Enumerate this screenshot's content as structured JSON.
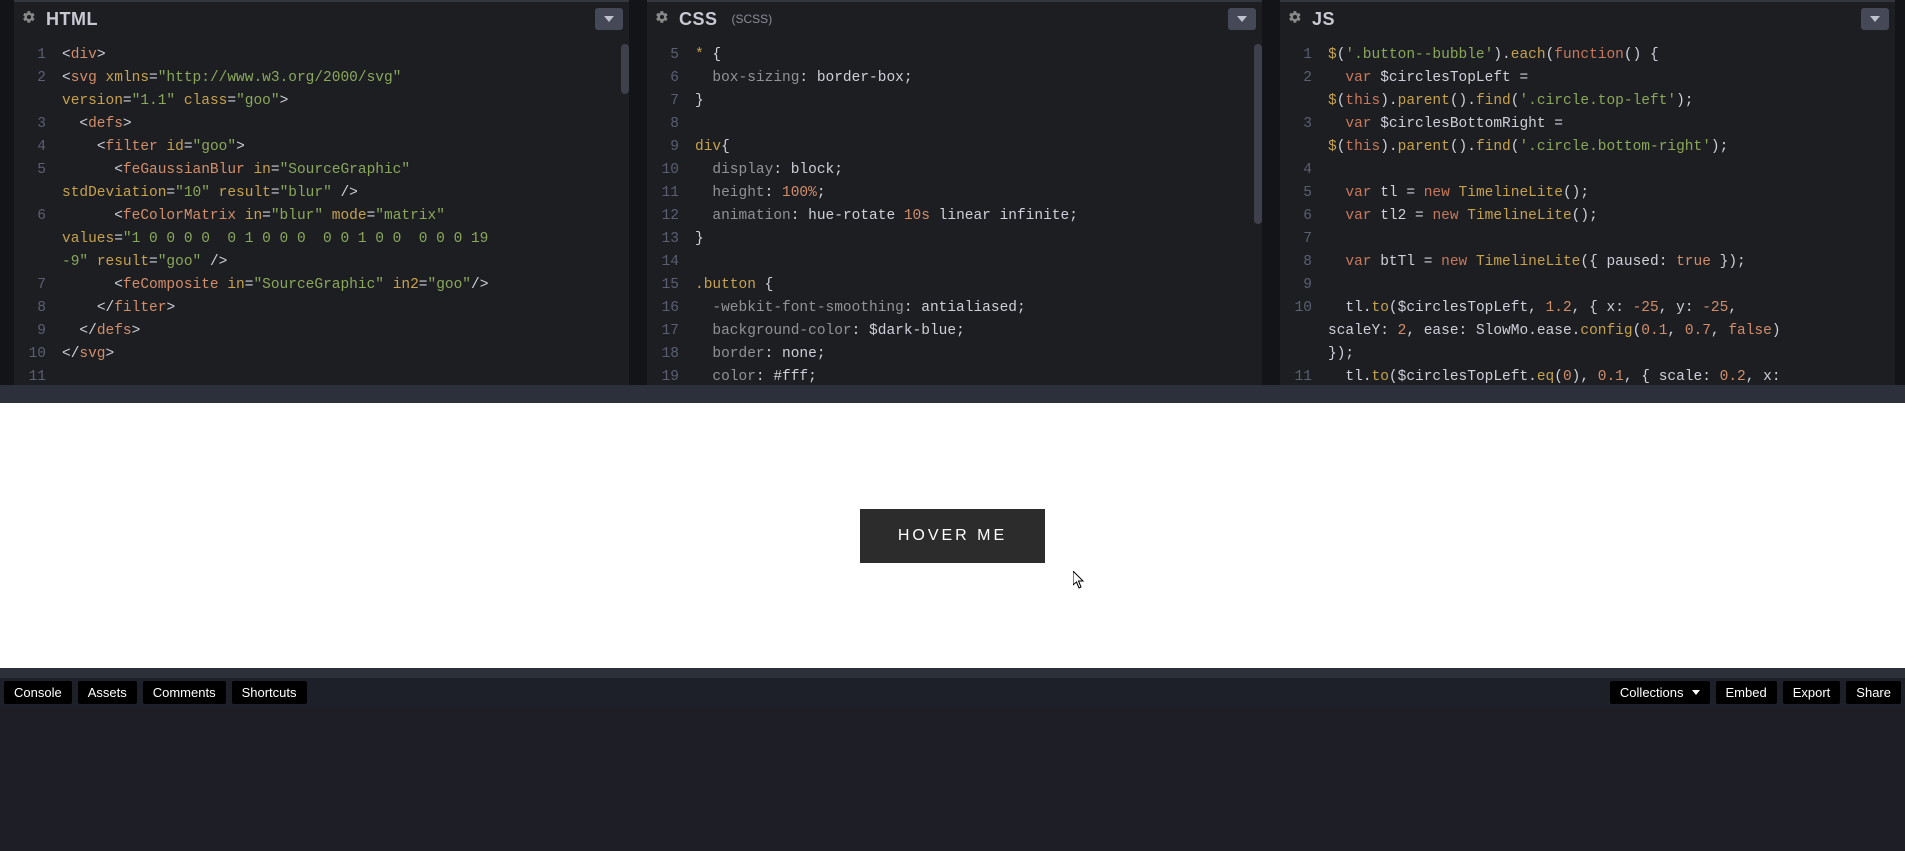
{
  "panels": {
    "html": {
      "title": "HTML",
      "sub": ""
    },
    "css": {
      "title": "CSS",
      "sub": "(SCSS)"
    },
    "js": {
      "title": "JS",
      "sub": ""
    }
  },
  "html_lines": [
    {
      "n": "1",
      "indent": 0,
      "segs": [
        [
          "t-punc",
          "<"
        ],
        [
          "t-tag",
          "div"
        ],
        [
          "t-punc",
          ">"
        ]
      ]
    },
    {
      "n": "2",
      "indent": 0,
      "segs": [
        [
          "t-punc",
          "<"
        ],
        [
          "t-tag",
          "svg"
        ],
        [
          "t-plain",
          " "
        ],
        [
          "t-attr",
          "xmlns"
        ],
        [
          "t-punc",
          "="
        ],
        [
          "t-str",
          "\"http://www.w3.org/2000/svg\""
        ]
      ]
    },
    {
      "n": "",
      "indent": 0,
      "segs": [
        [
          "t-attr",
          "version"
        ],
        [
          "t-punc",
          "="
        ],
        [
          "t-str",
          "\"1.1\""
        ],
        [
          "t-plain",
          " "
        ],
        [
          "t-attr",
          "class"
        ],
        [
          "t-punc",
          "="
        ],
        [
          "t-str",
          "\"goo\""
        ],
        [
          "t-punc",
          ">"
        ]
      ]
    },
    {
      "n": "3",
      "indent": 1,
      "segs": [
        [
          "t-punc",
          "<"
        ],
        [
          "t-tag",
          "defs"
        ],
        [
          "t-punc",
          ">"
        ]
      ]
    },
    {
      "n": "4",
      "indent": 2,
      "segs": [
        [
          "t-punc",
          "<"
        ],
        [
          "t-tag",
          "filter"
        ],
        [
          "t-plain",
          " "
        ],
        [
          "t-attr",
          "id"
        ],
        [
          "t-punc",
          "="
        ],
        [
          "t-str",
          "\"goo\""
        ],
        [
          "t-punc",
          ">"
        ]
      ]
    },
    {
      "n": "5",
      "indent": 3,
      "segs": [
        [
          "t-punc",
          "<"
        ],
        [
          "t-tag",
          "feGaussianBlur"
        ],
        [
          "t-plain",
          " "
        ],
        [
          "t-attr",
          "in"
        ],
        [
          "t-punc",
          "="
        ],
        [
          "t-str",
          "\"SourceGraphic\""
        ]
      ]
    },
    {
      "n": "",
      "indent": 0,
      "segs": [
        [
          "t-attr",
          "stdDeviation"
        ],
        [
          "t-punc",
          "="
        ],
        [
          "t-str",
          "\"10\""
        ],
        [
          "t-plain",
          " "
        ],
        [
          "t-attr",
          "result"
        ],
        [
          "t-punc",
          "="
        ],
        [
          "t-str",
          "\"blur\""
        ],
        [
          "t-plain",
          " "
        ],
        [
          "t-punc",
          "/>"
        ]
      ]
    },
    {
      "n": "6",
      "indent": 3,
      "segs": [
        [
          "t-punc",
          "<"
        ],
        [
          "t-tag",
          "feColorMatrix"
        ],
        [
          "t-plain",
          " "
        ],
        [
          "t-attr",
          "in"
        ],
        [
          "t-punc",
          "="
        ],
        [
          "t-str",
          "\"blur\""
        ],
        [
          "t-plain",
          " "
        ],
        [
          "t-attr",
          "mode"
        ],
        [
          "t-punc",
          "="
        ],
        [
          "t-str",
          "\"matrix\""
        ]
      ]
    },
    {
      "n": "",
      "indent": 0,
      "segs": [
        [
          "t-attr",
          "values"
        ],
        [
          "t-punc",
          "="
        ],
        [
          "t-str",
          "\"1 0 0 0 0  0 1 0 0 0  0 0 1 0 0  0 0 0 19"
        ]
      ]
    },
    {
      "n": "",
      "indent": 0,
      "segs": [
        [
          "t-str",
          "-9\""
        ],
        [
          "t-plain",
          " "
        ],
        [
          "t-attr",
          "result"
        ],
        [
          "t-punc",
          "="
        ],
        [
          "t-str",
          "\"goo\""
        ],
        [
          "t-plain",
          " "
        ],
        [
          "t-punc",
          "/>"
        ]
      ]
    },
    {
      "n": "7",
      "indent": 3,
      "segs": [
        [
          "t-punc",
          "<"
        ],
        [
          "t-tag",
          "feComposite"
        ],
        [
          "t-plain",
          " "
        ],
        [
          "t-attr",
          "in"
        ],
        [
          "t-punc",
          "="
        ],
        [
          "t-str",
          "\"SourceGraphic\""
        ],
        [
          "t-plain",
          " "
        ],
        [
          "t-attr",
          "in2"
        ],
        [
          "t-punc",
          "="
        ],
        [
          "t-str",
          "\"goo\""
        ],
        [
          "t-punc",
          "/>"
        ]
      ]
    },
    {
      "n": "8",
      "indent": 2,
      "segs": [
        [
          "t-punc",
          "</"
        ],
        [
          "t-tag",
          "filter"
        ],
        [
          "t-punc",
          ">"
        ]
      ]
    },
    {
      "n": "9",
      "indent": 1,
      "segs": [
        [
          "t-punc",
          "</"
        ],
        [
          "t-tag",
          "defs"
        ],
        [
          "t-punc",
          ">"
        ]
      ]
    },
    {
      "n": "10",
      "indent": 0,
      "segs": [
        [
          "t-punc",
          "</"
        ],
        [
          "t-tag",
          "svg"
        ],
        [
          "t-punc",
          ">"
        ]
      ]
    },
    {
      "n": "11",
      "indent": 0,
      "segs": []
    }
  ],
  "css_lines": [
    {
      "n": "5",
      "indent": 0,
      "segs": [
        [
          "t-sel",
          "*"
        ],
        [
          "t-plain",
          " "
        ],
        [
          "t-punc",
          "{"
        ]
      ]
    },
    {
      "n": "6",
      "indent": 1,
      "segs": [
        [
          "t-prop",
          "box-sizing"
        ],
        [
          "t-punc",
          ": "
        ],
        [
          "t-val",
          "border-box"
        ],
        [
          "t-punc",
          ";"
        ]
      ]
    },
    {
      "n": "7",
      "indent": 0,
      "segs": [
        [
          "t-punc",
          "}"
        ]
      ]
    },
    {
      "n": "8",
      "indent": 0,
      "segs": []
    },
    {
      "n": "9",
      "indent": 0,
      "segs": [
        [
          "t-sel",
          "div"
        ],
        [
          "t-punc",
          "{"
        ]
      ]
    },
    {
      "n": "10",
      "indent": 1,
      "segs": [
        [
          "t-prop",
          "display"
        ],
        [
          "t-punc",
          ": "
        ],
        [
          "t-val",
          "block"
        ],
        [
          "t-punc",
          ";"
        ]
      ]
    },
    {
      "n": "11",
      "indent": 1,
      "segs": [
        [
          "t-prop",
          "height"
        ],
        [
          "t-punc",
          ": "
        ],
        [
          "t-num",
          "100%"
        ],
        [
          "t-punc",
          ";"
        ]
      ]
    },
    {
      "n": "12",
      "indent": 1,
      "segs": [
        [
          "t-prop",
          "animation"
        ],
        [
          "t-punc",
          ": "
        ],
        [
          "t-val",
          "hue-rotate "
        ],
        [
          "t-num",
          "10s"
        ],
        [
          "t-val",
          " linear infinite"
        ],
        [
          "t-punc",
          ";"
        ]
      ]
    },
    {
      "n": "13",
      "indent": 0,
      "segs": [
        [
          "t-punc",
          "}"
        ]
      ]
    },
    {
      "n": "14",
      "indent": 0,
      "segs": []
    },
    {
      "n": "15",
      "indent": 0,
      "segs": [
        [
          "t-sel",
          ".button"
        ],
        [
          "t-plain",
          " "
        ],
        [
          "t-punc",
          "{"
        ]
      ]
    },
    {
      "n": "16",
      "indent": 1,
      "segs": [
        [
          "t-prop",
          "-webkit-font-smoothing"
        ],
        [
          "t-punc",
          ": "
        ],
        [
          "t-val",
          "antialiased"
        ],
        [
          "t-punc",
          ";"
        ]
      ]
    },
    {
      "n": "17",
      "indent": 1,
      "segs": [
        [
          "t-prop",
          "background-color"
        ],
        [
          "t-punc",
          ": "
        ],
        [
          "t-val",
          "$dark-blue"
        ],
        [
          "t-punc",
          ";"
        ]
      ]
    },
    {
      "n": "18",
      "indent": 1,
      "segs": [
        [
          "t-prop",
          "border"
        ],
        [
          "t-punc",
          ": "
        ],
        [
          "t-val",
          "none"
        ],
        [
          "t-punc",
          ";"
        ]
      ]
    },
    {
      "n": "19",
      "indent": 1,
      "segs": [
        [
          "t-prop",
          "color"
        ],
        [
          "t-punc",
          ": "
        ],
        [
          "t-val",
          "#fff"
        ],
        [
          "t-punc",
          ";"
        ]
      ]
    }
  ],
  "js_lines": [
    {
      "n": "1",
      "indent": 0,
      "segs": [
        [
          "t-fn",
          "$"
        ],
        [
          "t-punc",
          "("
        ],
        [
          "t-str",
          "'.button--bubble'"
        ],
        [
          "t-punc",
          ")."
        ],
        [
          "t-fn",
          "each"
        ],
        [
          "t-punc",
          "("
        ],
        [
          "t-kw",
          "function"
        ],
        [
          "t-punc",
          "() {"
        ]
      ]
    },
    {
      "n": "2",
      "indent": 1,
      "segs": [
        [
          "t-kw",
          "var"
        ],
        [
          "t-plain",
          " "
        ],
        [
          "t-var",
          "$circlesTopLeft"
        ],
        [
          "t-plain",
          " "
        ],
        [
          "t-punc",
          "="
        ],
        [
          "t-plain",
          " "
        ]
      ]
    },
    {
      "n": "",
      "indent": 0,
      "segs": [
        [
          "t-fn",
          "$"
        ],
        [
          "t-punc",
          "("
        ],
        [
          "t-kw",
          "this"
        ],
        [
          "t-punc",
          ")."
        ],
        [
          "t-fn",
          "parent"
        ],
        [
          "t-punc",
          "()."
        ],
        [
          "t-fn",
          "find"
        ],
        [
          "t-punc",
          "("
        ],
        [
          "t-str",
          "'.circle.top-left'"
        ],
        [
          "t-punc",
          ");"
        ]
      ]
    },
    {
      "n": "3",
      "indent": 1,
      "segs": [
        [
          "t-kw",
          "var"
        ],
        [
          "t-plain",
          " "
        ],
        [
          "t-var",
          "$circlesBottomRight"
        ],
        [
          "t-plain",
          " "
        ],
        [
          "t-punc",
          "="
        ],
        [
          "t-plain",
          " "
        ]
      ]
    },
    {
      "n": "",
      "indent": 0,
      "segs": [
        [
          "t-fn",
          "$"
        ],
        [
          "t-punc",
          "("
        ],
        [
          "t-kw",
          "this"
        ],
        [
          "t-punc",
          ")."
        ],
        [
          "t-fn",
          "parent"
        ],
        [
          "t-punc",
          "()."
        ],
        [
          "t-fn",
          "find"
        ],
        [
          "t-punc",
          "("
        ],
        [
          "t-str",
          "'.circle.bottom-right'"
        ],
        [
          "t-punc",
          ");"
        ]
      ]
    },
    {
      "n": "4",
      "indent": 0,
      "segs": []
    },
    {
      "n": "5",
      "indent": 1,
      "segs": [
        [
          "t-kw",
          "var"
        ],
        [
          "t-plain",
          " "
        ],
        [
          "t-var",
          "tl"
        ],
        [
          "t-plain",
          " "
        ],
        [
          "t-punc",
          "="
        ],
        [
          "t-plain",
          " "
        ],
        [
          "t-kw",
          "new"
        ],
        [
          "t-plain",
          " "
        ],
        [
          "t-fn",
          "TimelineLite"
        ],
        [
          "t-punc",
          "();"
        ]
      ]
    },
    {
      "n": "6",
      "indent": 1,
      "segs": [
        [
          "t-kw",
          "var"
        ],
        [
          "t-plain",
          " "
        ],
        [
          "t-var",
          "tl2"
        ],
        [
          "t-plain",
          " "
        ],
        [
          "t-punc",
          "="
        ],
        [
          "t-plain",
          " "
        ],
        [
          "t-kw",
          "new"
        ],
        [
          "t-plain",
          " "
        ],
        [
          "t-fn",
          "TimelineLite"
        ],
        [
          "t-punc",
          "();"
        ]
      ]
    },
    {
      "n": "7",
      "indent": 0,
      "segs": []
    },
    {
      "n": "8",
      "indent": 1,
      "segs": [
        [
          "t-kw",
          "var"
        ],
        [
          "t-plain",
          " "
        ],
        [
          "t-var",
          "btTl"
        ],
        [
          "t-plain",
          " "
        ],
        [
          "t-punc",
          "="
        ],
        [
          "t-plain",
          " "
        ],
        [
          "t-kw",
          "new"
        ],
        [
          "t-plain",
          " "
        ],
        [
          "t-fn",
          "TimelineLite"
        ],
        [
          "t-punc",
          "({ "
        ],
        [
          "t-var",
          "paused"
        ],
        [
          "t-punc",
          ": "
        ],
        [
          "t-bool",
          "true"
        ],
        [
          "t-punc",
          " });"
        ]
      ]
    },
    {
      "n": "9",
      "indent": 0,
      "segs": []
    },
    {
      "n": "10",
      "indent": 1,
      "segs": [
        [
          "t-var",
          "tl"
        ],
        [
          "t-punc",
          "."
        ],
        [
          "t-fn",
          "to"
        ],
        [
          "t-punc",
          "("
        ],
        [
          "t-var",
          "$circlesTopLeft"
        ],
        [
          "t-punc",
          ", "
        ],
        [
          "t-num",
          "1.2"
        ],
        [
          "t-punc",
          ", { "
        ],
        [
          "t-var",
          "x"
        ],
        [
          "t-punc",
          ": "
        ],
        [
          "t-num",
          "-25"
        ],
        [
          "t-punc",
          ", "
        ],
        [
          "t-var",
          "y"
        ],
        [
          "t-punc",
          ": "
        ],
        [
          "t-num",
          "-25"
        ],
        [
          "t-punc",
          ","
        ]
      ]
    },
    {
      "n": "",
      "indent": 0,
      "segs": [
        [
          "t-var",
          "scaleY"
        ],
        [
          "t-punc",
          ": "
        ],
        [
          "t-num",
          "2"
        ],
        [
          "t-punc",
          ", "
        ],
        [
          "t-var",
          "ease"
        ],
        [
          "t-punc",
          ": "
        ],
        [
          "t-var",
          "SlowMo.ease"
        ],
        [
          "t-punc",
          "."
        ],
        [
          "t-fn",
          "config"
        ],
        [
          "t-punc",
          "("
        ],
        [
          "t-num",
          "0.1"
        ],
        [
          "t-punc",
          ", "
        ],
        [
          "t-num",
          "0.7"
        ],
        [
          "t-punc",
          ", "
        ],
        [
          "t-bool",
          "false"
        ],
        [
          "t-punc",
          ")"
        ]
      ]
    },
    {
      "n": "",
      "indent": 0,
      "segs": [
        [
          "t-punc",
          "});"
        ]
      ]
    },
    {
      "n": "11",
      "indent": 1,
      "segs": [
        [
          "t-var",
          "tl"
        ],
        [
          "t-punc",
          "."
        ],
        [
          "t-fn",
          "to"
        ],
        [
          "t-punc",
          "("
        ],
        [
          "t-var",
          "$circlesTopLeft"
        ],
        [
          "t-punc",
          "."
        ],
        [
          "t-fn",
          "eq"
        ],
        [
          "t-punc",
          "("
        ],
        [
          "t-num",
          "0"
        ],
        [
          "t-punc",
          "), "
        ],
        [
          "t-num",
          "0.1"
        ],
        [
          "t-punc",
          ", { "
        ],
        [
          "t-var",
          "scale"
        ],
        [
          "t-punc",
          ": "
        ],
        [
          "t-num",
          "0.2"
        ],
        [
          "t-punc",
          ", "
        ],
        [
          "t-var",
          "x"
        ],
        [
          "t-punc",
          ":"
        ]
      ]
    }
  ],
  "preview": {
    "button_label": "HOVER ME"
  },
  "footer": {
    "left": [
      "Console",
      "Assets",
      "Comments",
      "Shortcuts"
    ],
    "right": [
      "Collections",
      "Embed",
      "Export",
      "Share"
    ]
  }
}
